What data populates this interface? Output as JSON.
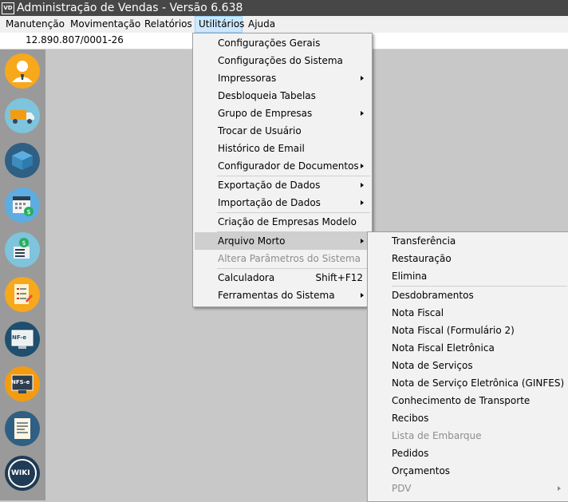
{
  "window": {
    "icon_label": "VD",
    "title": "Administração de Vendas - Versão 6.638"
  },
  "menubar": {
    "items": [
      "Manutenção",
      "Movimentação",
      "Relatórios",
      "Utilitários",
      "Ajuda"
    ],
    "active": "Utilitários"
  },
  "info": {
    "cnpj": "12.890.807/0001-26"
  },
  "sidebar": {
    "icons": [
      "user-manager-icon",
      "delivery-truck-icon",
      "box-icon",
      "calendar-money-icon",
      "money-list-icon",
      "checklist-icon",
      "nfe-icon",
      "nfse-icon",
      "receipt-icon",
      "wiki-icon"
    ],
    "labels": {
      "nfe": "NF-e",
      "nfse": "NFS-e",
      "wiki": "WIKI"
    }
  },
  "utilitarios_menu": {
    "items": [
      {
        "label": "Configurações Gerais"
      },
      {
        "label": "Configurações do Sistema"
      },
      {
        "label": "Impressoras",
        "submenu": true
      },
      {
        "label": "Desbloqueia Tabelas"
      },
      {
        "label": "Grupo de Empresas",
        "submenu": true
      },
      {
        "label": "Trocar de Usuário"
      },
      {
        "label": "Histórico de Email"
      },
      {
        "label": "Configurador de Documentos",
        "submenu": true
      },
      {
        "label": "Exportação de Dados",
        "submenu": true
      },
      {
        "label": "Importação de Dados",
        "submenu": true
      },
      {
        "label": "Criação de Empresas Modelo"
      },
      {
        "label": "Arquivo Morto",
        "submenu": true,
        "highlighted": true
      },
      {
        "label": "Altera Parâmetros do Sistema",
        "disabled": true
      },
      {
        "label": "Calculadora",
        "shortcut": "Shift+F12"
      },
      {
        "label": "Ferramentas do Sistema",
        "submenu": true
      }
    ]
  },
  "arquivo_morto_menu": {
    "items": [
      {
        "label": "Transferência"
      },
      {
        "label": "Restauração"
      },
      {
        "label": "Elimina"
      },
      {
        "label": "Desdobramentos"
      },
      {
        "label": "Nota Fiscal"
      },
      {
        "label": "Nota Fiscal (Formulário 2)"
      },
      {
        "label": "Nota Fiscal Eletrônica"
      },
      {
        "label": "Nota de Serviços"
      },
      {
        "label": "Nota de Serviço Eletrônica (GINFES)"
      },
      {
        "label": "Conhecimento de Transporte"
      },
      {
        "label": "Recibos"
      },
      {
        "label": "Lista de Embarque",
        "disabled": true
      },
      {
        "label": "Pedidos"
      },
      {
        "label": "Orçamentos"
      },
      {
        "label": "PDV",
        "disabled": true,
        "submenu": true
      }
    ]
  },
  "colors": {
    "titlebar": "#474747",
    "menu_active_bg": "#cce8ff",
    "menu_highlight": "#cfcfcf",
    "sidebar_bg": "#9a9a9a",
    "workspace_bg": "#c8c8c8",
    "disabled_text": "#8d8d8d"
  }
}
